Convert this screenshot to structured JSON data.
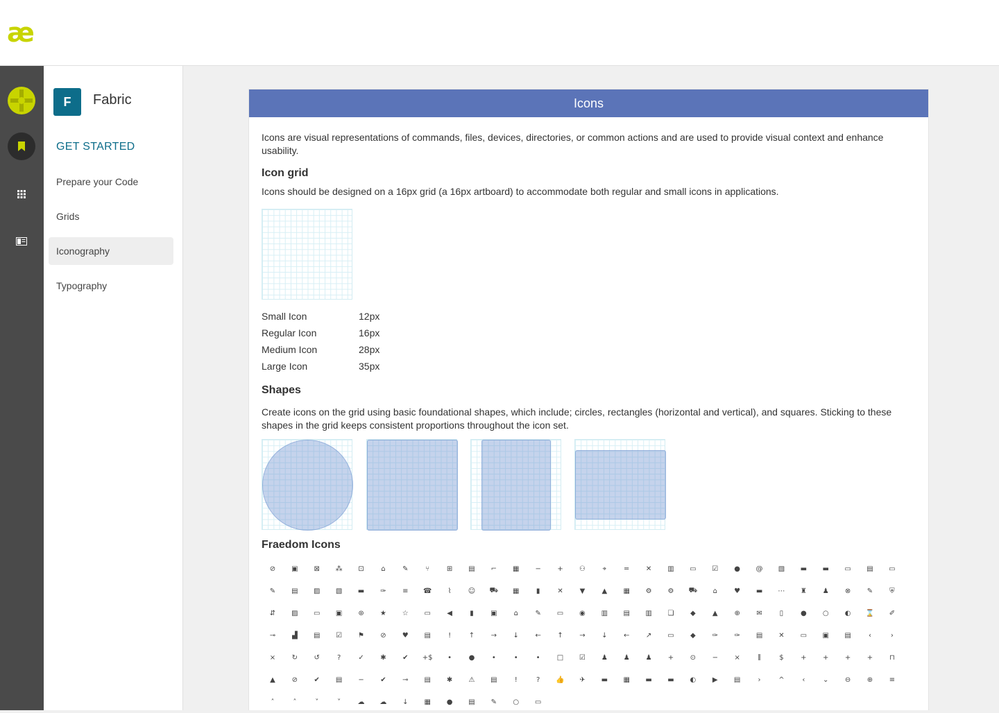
{
  "colors": {
    "brand_lime": "#c8d400",
    "header_blue": "#5b74b8",
    "brand_teal": "#0d6d8a",
    "rail_dark": "#4a4a4a"
  },
  "logo": {
    "text": "æ",
    "icon": "ae-logo-icon"
  },
  "rail": {
    "items": [
      {
        "name": "fabric-app-icon",
        "glyph": "✚"
      },
      {
        "name": "bookmark-icon",
        "glyph": "▮"
      },
      {
        "name": "apps-grid-icon",
        "glyph": "▦"
      },
      {
        "name": "reader-icon",
        "glyph": "▤"
      }
    ]
  },
  "sidebar": {
    "brand_initial": "F",
    "brand_name": "Fabric",
    "section_title": "GET STARTED",
    "items": [
      {
        "label": "Prepare your Code"
      },
      {
        "label": "Grids"
      },
      {
        "label": "Iconography",
        "active": true
      },
      {
        "label": "Typography"
      }
    ]
  },
  "main": {
    "title": "Icons",
    "intro": "Icons are visual representations of commands, files, devices, directories, or common actions and are used to provide visual context and enhance usability.",
    "grid_heading": "Icon grid",
    "grid_text": "Icons should be designed on a 16px grid (a 16px artboard) to accommodate both regular and small icons in applications.",
    "sizes": [
      {
        "name": "Small Icon",
        "value": "12px"
      },
      {
        "name": "Regular Icon",
        "value": "16px"
      },
      {
        "name": "Medium Icon",
        "value": "28px"
      },
      {
        "name": "Large Icon",
        "value": "35px"
      }
    ],
    "shapes_heading": "Shapes",
    "shapes_text": "Create icons on the grid using basic foundational shapes, which include; circles, rectangles (horizontal and vertical), and squares. Sticking to these shapes in the grid keeps consistent proportions throughout the icon set.",
    "shape_names": [
      "circle-shape",
      "square-shape",
      "vertical-rectangle-shape",
      "horizontal-rectangle-shape"
    ],
    "icons_heading": "Fraedom Icons",
    "icon_glyphs": [
      "⊘",
      "▣",
      "⊠",
      "⁂",
      "⊡",
      "⌂",
      "✎",
      "⑂",
      "⊞",
      "▤",
      "⌐",
      "▦",
      "−",
      "+",
      "⚇",
      "⌖",
      "═",
      "✕",
      "▥",
      "▭",
      "☑",
      "●",
      "@",
      "▧",
      "▬",
      "▬",
      "▭",
      "▤",
      "▭",
      "✎",
      "▤",
      "▨",
      "▧",
      "▬",
      "✑",
      "≡",
      "☎",
      "⌇",
      "☺",
      "⛟",
      "▦",
      "▮",
      "✕",
      "▼",
      "▲",
      "▦",
      "⚙",
      "⚙",
      "⛟",
      "⌂",
      "♥",
      "▬",
      "⋯",
      "♜",
      "♟",
      "⊗",
      "✎",
      "⛨",
      "⇵",
      "▨",
      "▭",
      "▣",
      "⊛",
      "★",
      "☆",
      "▭",
      "◀",
      "▮",
      "▣",
      "⌂",
      "✎",
      "▭",
      "◉",
      "▥",
      "▤",
      "▥",
      "❏",
      "◆",
      "▲",
      "⊕",
      "✉",
      "▯",
      "●",
      "○",
      "◐",
      "⌛",
      "✐",
      "⊸",
      "▟",
      "▤",
      "☑",
      "⚑",
      "⊘",
      "♥",
      "▤",
      "!",
      "↑",
      "→",
      "↓",
      "←",
      "↑",
      "→",
      "↓",
      "←",
      "↗",
      "▭",
      "◆",
      "✑",
      "✑",
      "▤",
      "✕",
      "▭",
      "▣",
      "▤",
      "‹",
      "›",
      "×",
      "↻",
      "↺",
      "?",
      "✓",
      "✱",
      "✔",
      "+$",
      "•",
      "●",
      "•",
      "•",
      "•",
      "□",
      "☑",
      "♟",
      "♟",
      "♟",
      "+",
      "⊙",
      "−",
      "×",
      "⫼",
      "$",
      "+",
      "+",
      "+",
      "+",
      "⊓",
      "▲",
      "⊘",
      "✔",
      "▤",
      "−",
      "✔",
      "⊸",
      "▤",
      "✱",
      "⚠",
      "▤",
      "!",
      "?",
      "👍",
      "✈",
      "▬",
      "▦",
      "▬",
      "▬",
      "◐",
      "▶",
      "▤",
      "›",
      "^",
      "‹",
      "⌄",
      "⊖",
      "⊕",
      "≡",
      "˄",
      "˄",
      "˅",
      "˅",
      "☁",
      "☁",
      "↓",
      "▦",
      "●",
      "▤",
      "✎",
      "○",
      "▭"
    ]
  }
}
